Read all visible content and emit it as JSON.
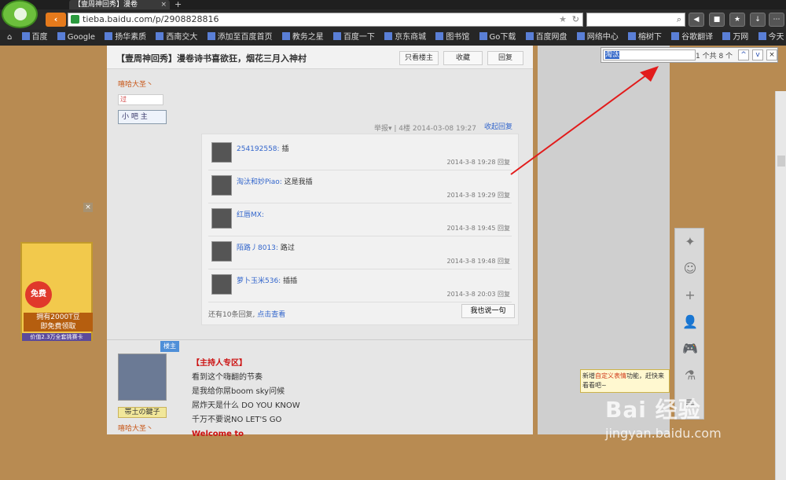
{
  "browser": {
    "tab_title": "【壹周神回秀】漫卷",
    "url": "tieba.baidu.com/p/2908828816",
    "bookmarks": [
      "百度",
      "Google",
      "扬华素质",
      "西南交大",
      "添加至百度首页",
      "教务之星",
      "百度一下",
      "京东商城",
      "图书馆",
      "Go下载",
      "百度网盘",
      "网络中心",
      "榕树下",
      "谷歌翻译",
      "万网",
      "今天"
    ]
  },
  "post": {
    "title": "【壹周神回秀】漫卷诗书喜欲狂，烟花三月入神村",
    "btn_owner": "只看楼主",
    "btn_fav": "收藏",
    "btn_reply": "回复",
    "rank": "嘻哈大圣丶",
    "title_badge": "过",
    "admin": "小 吧 主",
    "meta": "举报▾ | 4楼  2014-03-08 19:27",
    "collapse": "收起回复"
  },
  "comments": [
    {
      "user": "254192558:",
      "text": "插",
      "time": "2014-3-8 19:28  回复"
    },
    {
      "user": "淘汰和妙Piao:",
      "text": "这是我插",
      "time": "2014-3-8 19:29  回复"
    },
    {
      "user": "红唇MX:",
      "text": "",
      "time": "2014-3-8 19:45  回复"
    },
    {
      "user": "陌路丿8013:",
      "text": "路过",
      "time": "2014-3-8 19:48  回复"
    },
    {
      "user": "萝卜玉米536:",
      "text": "插插",
      "time": "2014-3-8 20:03  回复"
    }
  ],
  "comments_footer": {
    "more": "还有10条回复,",
    "link": "点击查看"
  },
  "say_button": "我也说一句",
  "host": {
    "corner": "楼主",
    "tag": "帯土の鍵子",
    "rank": "嘻哈大圣丶",
    "lines": [
      "【主持人专区】",
      "看到这个嗨翻的节奏",
      "是我给你屌boom sky问候",
      "屌炸天是什么 DO YOU KNOW",
      "千万不要说NO LET'S GO",
      "Welcome to"
    ]
  },
  "ad": {
    "free": "免费",
    "line1": "拥有2000T豆",
    "line2": "即免费领取",
    "bottom": "价值2.3万全套挑赛卡"
  },
  "find": {
    "query": "淘汰",
    "count": "1 个共 8 个"
  },
  "tooltip": {
    "pre": "新增",
    "highlight": "自定义表情",
    "post": "功能，赶快来看看吧~"
  },
  "watermark": {
    "logo": "Bai 经验",
    "url": "jingyan.baidu.com"
  },
  "colors": {
    "accent": "#e57a1c",
    "link": "#3366cc",
    "highlight": "#cc1111"
  }
}
